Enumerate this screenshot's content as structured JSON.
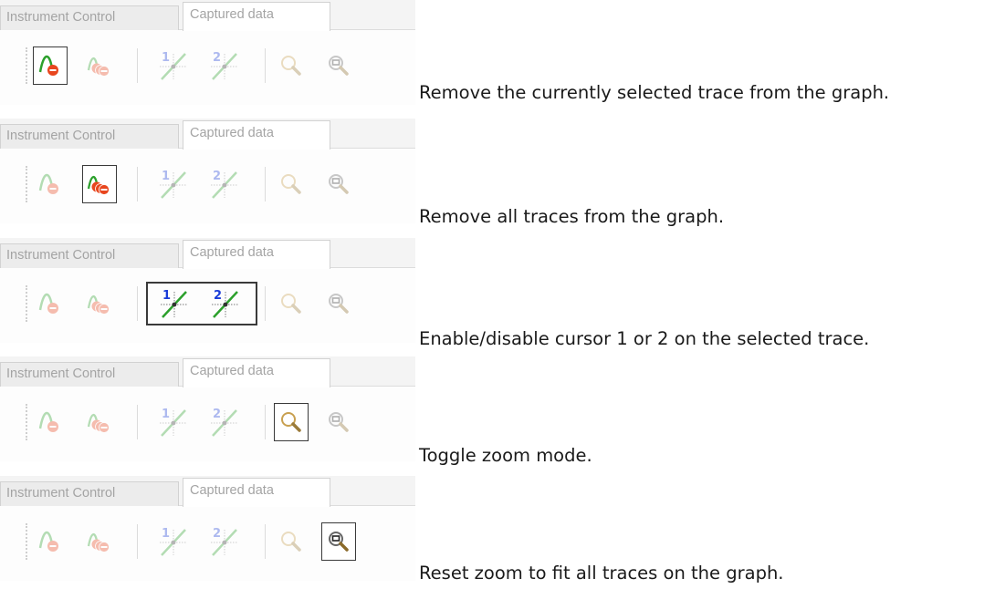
{
  "tabs": [
    "Instrument Control",
    "Captured data"
  ],
  "rows": [
    {
      "highlight": "remove-trace",
      "caption": "Remove the currently selected trace from the graph."
    },
    {
      "highlight": "remove-all",
      "caption": "Remove all traces from the graph."
    },
    {
      "highlight": "cursors",
      "caption": "Enable/disable cursor 1 or 2 on the selected trace."
    },
    {
      "highlight": "zoom",
      "caption": "Toggle zoom mode."
    },
    {
      "highlight": "reset-zoom",
      "caption": "Reset zoom to fit all traces on the graph."
    }
  ],
  "toolbar_buttons": [
    {
      "id": "remove-trace",
      "icon": "remove-trace-icon"
    },
    {
      "id": "remove-all",
      "icon": "remove-all-traces-icon"
    },
    {
      "id": "cursor1",
      "icon": "cursor-1-icon",
      "label": "1"
    },
    {
      "id": "cursor2",
      "icon": "cursor-2-icon",
      "label": "2"
    },
    {
      "id": "zoom",
      "icon": "zoom-icon"
    },
    {
      "id": "reset-zoom",
      "icon": "reset-zoom-icon"
    }
  ],
  "colors": {
    "trace": "#2ca02c",
    "remove": "#e8461e",
    "cursor_label": "#1a3cd8",
    "magnifier": "#c8a050"
  }
}
